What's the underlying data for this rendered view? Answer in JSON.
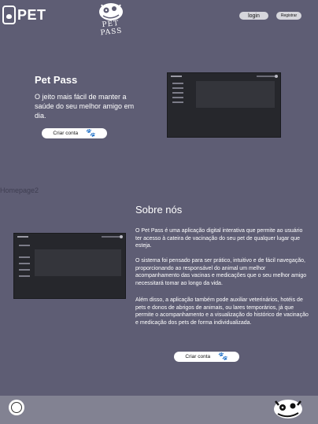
{
  "header": {
    "logo_left_text": "PET",
    "logo_center_text": "PET PASS",
    "login_label": "login",
    "register_label": "Registrar"
  },
  "hero": {
    "title": "Pet Pass",
    "subtitle": "O jeito mais fácil de manter a saúde do seu melhor amigo em dia.",
    "cta_label": "Criar conta",
    "cta_icon": "paw-icon"
  },
  "section_caption": "Homepage2",
  "about": {
    "title": "Sobre nós",
    "paragraphs": [
      "O Pet Pass é uma aplicação digital interativa que permite ao usuário ter acesso à cateira de vacinação do seu pet de qualquer lugar que esteja.",
      "O sistema foi pensado para ser prático, intuitivo e de fácil navegação, proporcionando ao responsável do animal um melhor acompanhamento das vacinas e medicações que o seu melhor amigo necessitará tomar ao longo da vida.",
      "Além disso, a aplicação também pode auxiliar veterinários, hotéis de pets e donos de abrigos de animais, ou lares temporários, já que permite o acompanhamento e a visualização do histórico de vacinação e medicação dos pets de forma individualizada."
    ],
    "cta_label": "Criar conta",
    "cta_icon": "paw-icon"
  },
  "footer": {
    "icon_left": "accessibility-icon",
    "logo_right": "pet-pass-logo"
  },
  "colors": {
    "background": "#5e5d74",
    "footer": "#828292",
    "preview_bg": "#26272c"
  }
}
